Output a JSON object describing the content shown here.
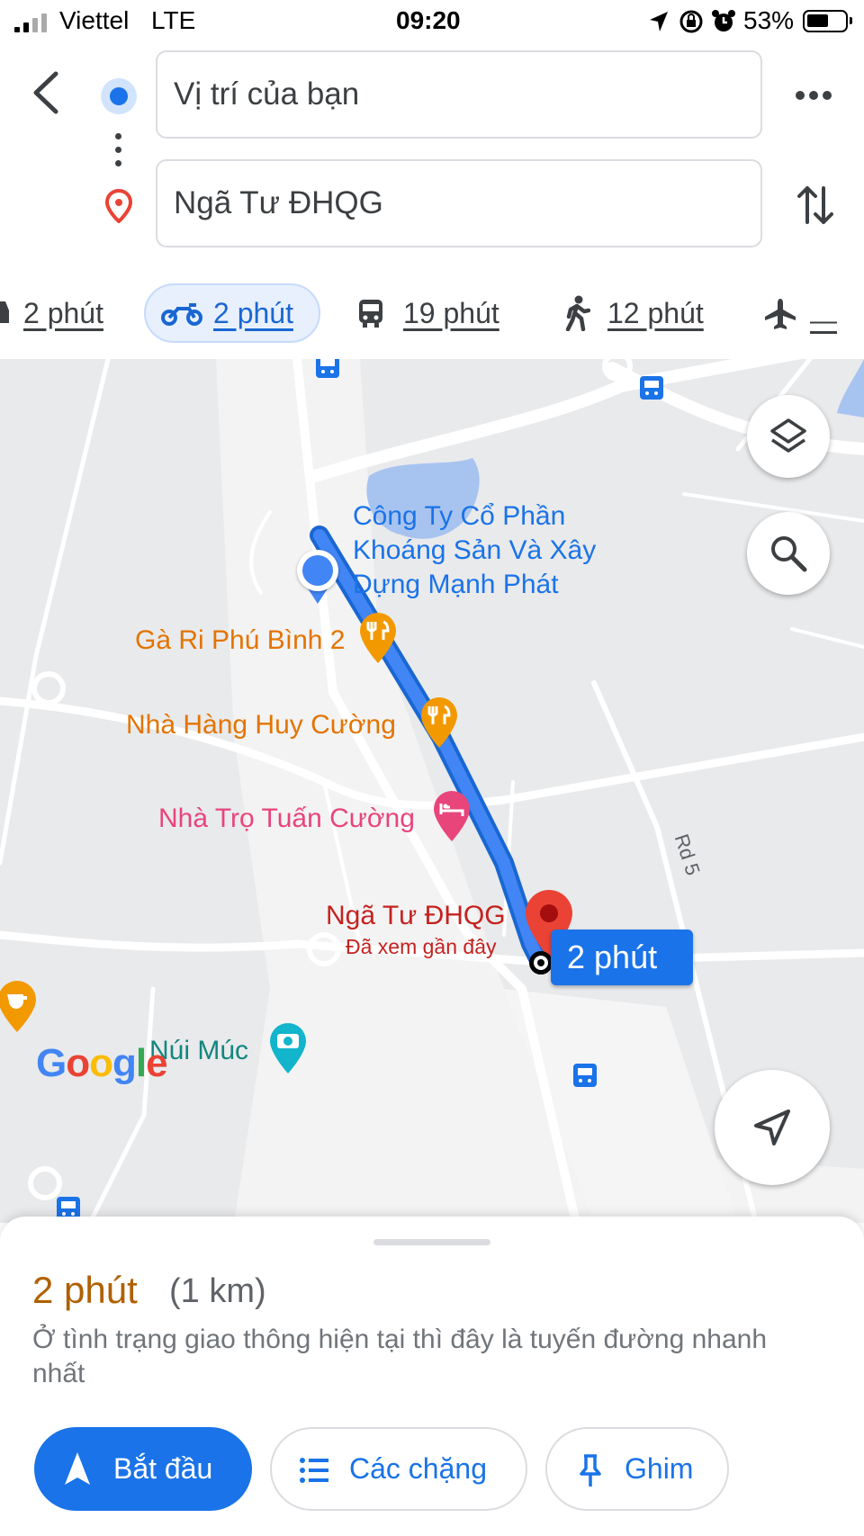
{
  "status_bar": {
    "carrier": "Viettel",
    "network": "LTE",
    "time": "09:20",
    "battery": "53%"
  },
  "header": {
    "origin_value": "Vị trí của bạn",
    "destination_value": "Ngã Tư ĐHQG"
  },
  "modes": [
    {
      "label": "2 phút",
      "icon": "car-icon"
    },
    {
      "label": "2 phút",
      "icon": "motorbike-icon",
      "selected": true
    },
    {
      "label": "19 phút",
      "icon": "transit-icon"
    },
    {
      "label": "12 phút",
      "icon": "walk-icon"
    },
    {
      "label": "—",
      "icon": "flight-icon"
    }
  ],
  "map": {
    "poi_company": [
      "Công Ty Cổ Phần",
      "Khoáng Sản Và Xây",
      "Dựng Mạnh Phát"
    ],
    "poi_restaurant_1": "Gà Ri Phú Bình 2",
    "poi_restaurant_2": "Nhà Hàng Huy Cường",
    "poi_hotel": "Nhà Trọ Tuấn Cường",
    "destination_label": "Ngã Tư ĐHQG",
    "destination_sub": "Đã xem gần đây",
    "road_label": "Rd 5",
    "poi_mountain": "Núi Múc",
    "route_callout": "2 phút",
    "google_logo": "Google",
    "colors": {
      "route": "#4285f4",
      "route_outline": "#1967d2",
      "food": "#f29900",
      "hotel": "#e8457b",
      "dest": "#ea4335",
      "poi_blue": "#1a73e8",
      "park": "#12b5cb"
    }
  },
  "summary": {
    "duration": "2 phút",
    "distance": "(1 km)",
    "description": "Ở tình trạng giao thông hiện tại thì đây là tuyến đường nhanh nhất"
  },
  "actions": {
    "start": "Bắt đầu",
    "steps": "Các chặng",
    "pin": "Ghim"
  }
}
